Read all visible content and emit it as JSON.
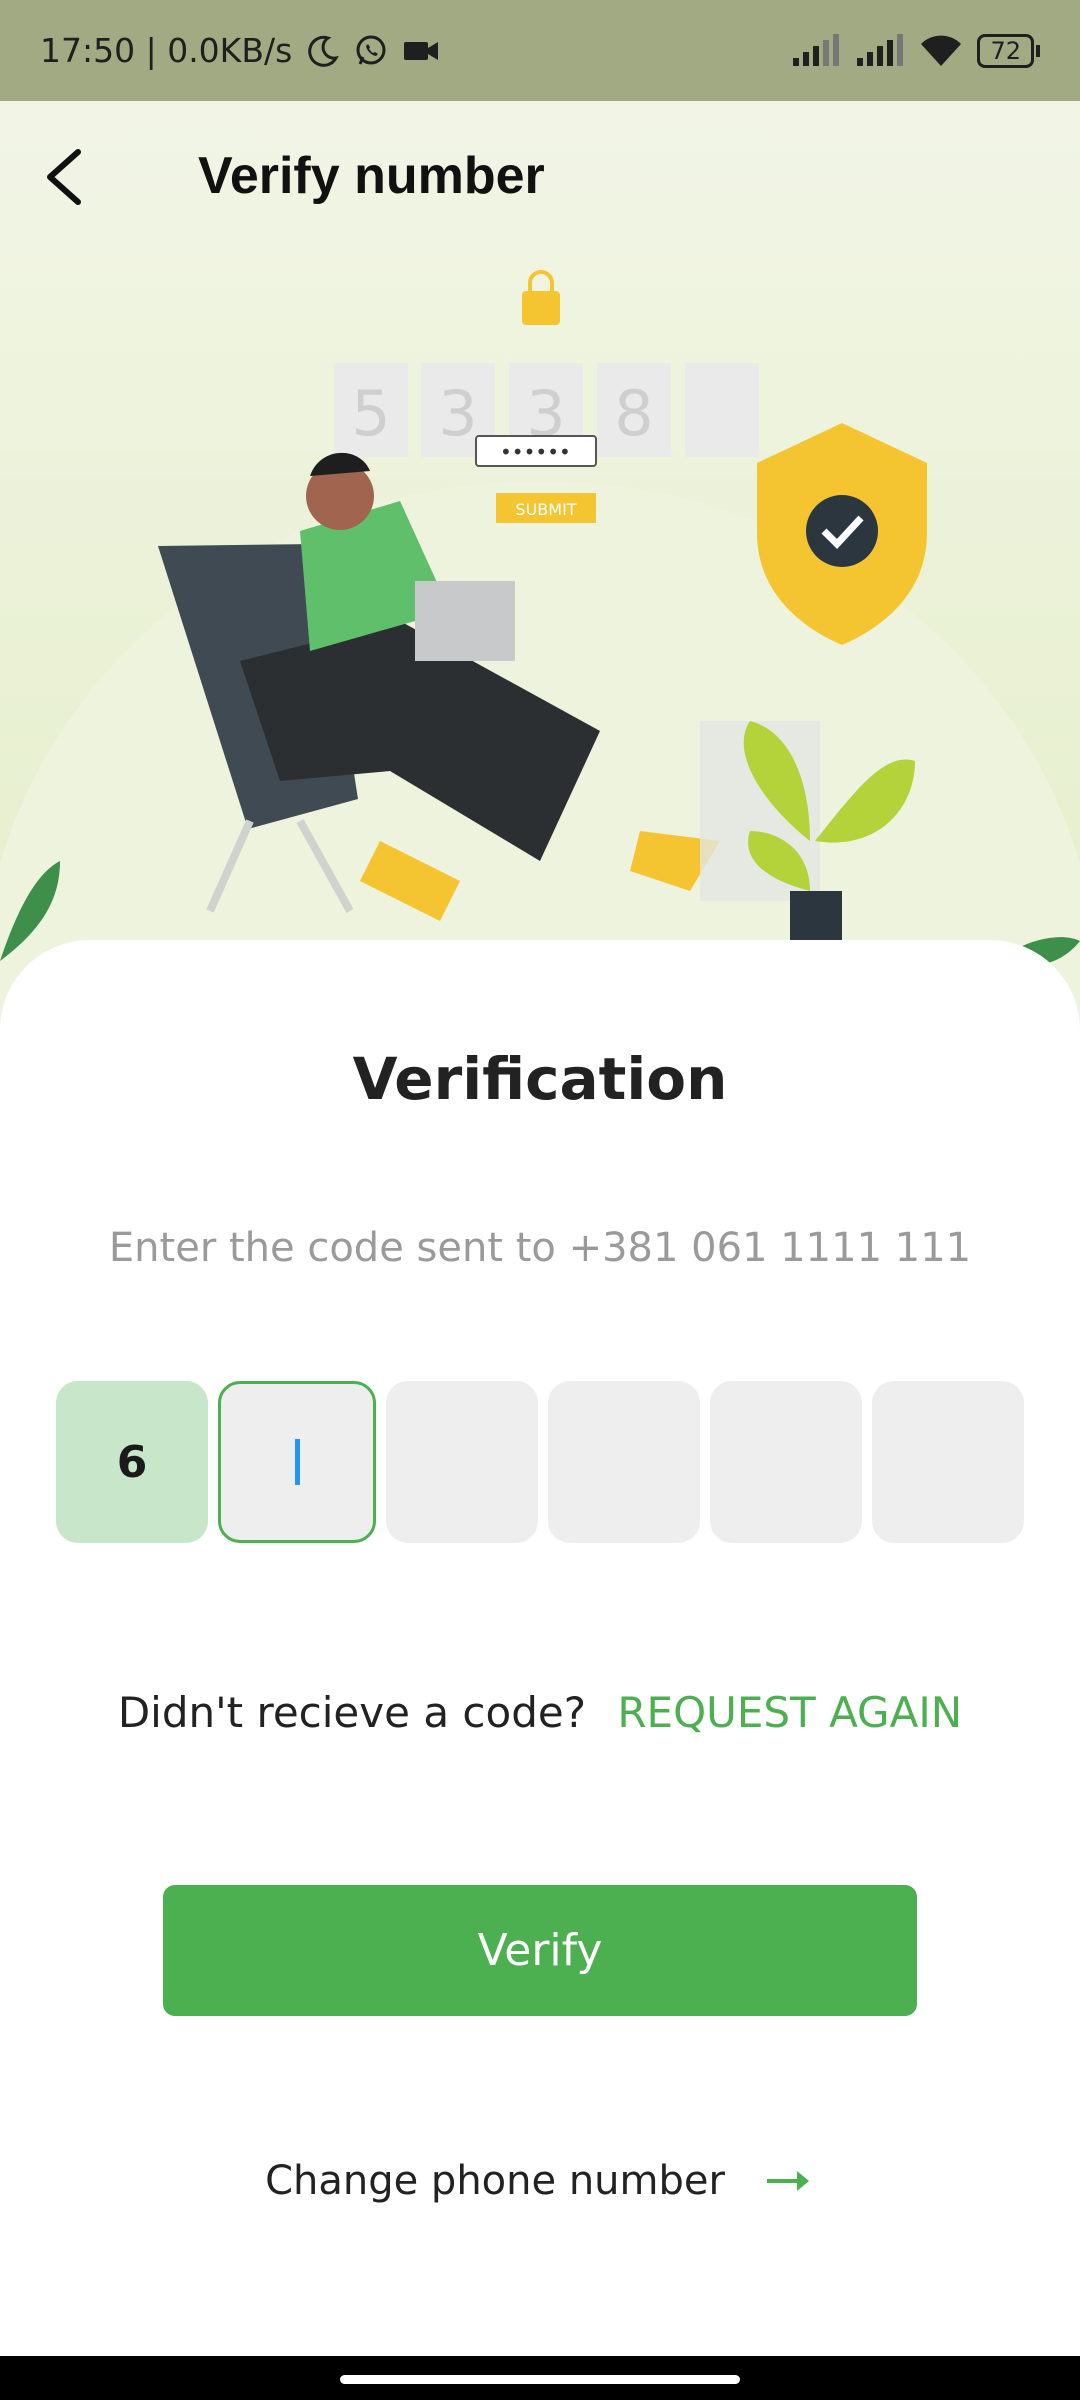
{
  "status_bar": {
    "time_speed": "17:50 | 0.0KB/s",
    "battery": "72",
    "icons": [
      "moon-icon",
      "whatsapp-icon",
      "video-camera-icon",
      "signal-icon",
      "signal-icon",
      "wifi-icon",
      "battery-icon"
    ]
  },
  "header": {
    "title": "Verify number",
    "back_icon": "chevron-left-icon"
  },
  "illustration": {
    "code_digits": [
      "5",
      "3",
      "3",
      "8",
      ""
    ],
    "password_dots": "••••••",
    "submit_label": "SUBMIT"
  },
  "verification": {
    "title": "Verification",
    "subtitle": "Enter the code sent to +381 061 1111 111",
    "code": [
      "6",
      "",
      "",
      "",
      "",
      ""
    ]
  },
  "resend": {
    "question": "Didn't recieve a code?",
    "action": "REQUEST AGAIN"
  },
  "verify_button": {
    "label": "Verify"
  },
  "change_phone": {
    "label": "Change phone number"
  },
  "colors": {
    "accent": "#4caf50",
    "filled_box": "#c8e6c9",
    "empty_box": "#eeeeee",
    "status_bar": "#a2aa84"
  }
}
